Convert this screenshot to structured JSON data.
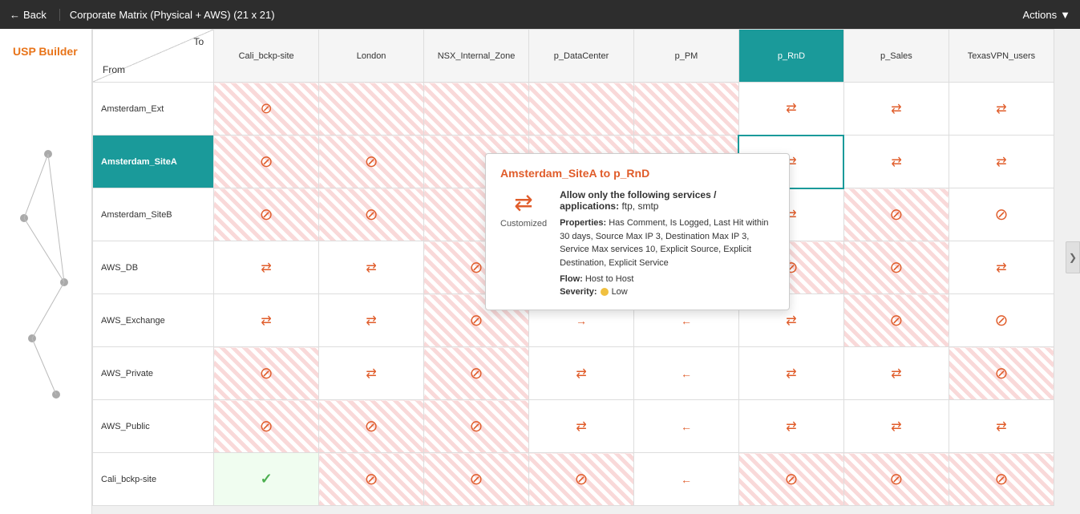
{
  "topbar": {
    "back_label": "Back",
    "title": "Corporate Matrix (Physical + AWS)  (21 x 21)",
    "actions_label": "Actions"
  },
  "sidebar": {
    "logo": "USP Builder"
  },
  "matrix": {
    "corner_to": "To",
    "corner_from": "From",
    "columns": [
      "Cali_bckp-site",
      "London",
      "NSX_Internal_Zone",
      "p_DataCenter",
      "p_PM",
      "p_RnD",
      "p_Sales",
      "TexasVPN_users"
    ],
    "rows": [
      {
        "label": "Amsterdam_Ext",
        "active": false
      },
      {
        "label": "Amsterdam_SiteA",
        "active": true
      },
      {
        "label": "Amsterdam_SiteB",
        "active": false
      },
      {
        "label": "AWS_DB",
        "active": false
      },
      {
        "label": "AWS_Exchange",
        "active": false
      },
      {
        "label": "AWS_Private",
        "active": false
      },
      {
        "label": "AWS_Public",
        "active": false
      },
      {
        "label": "Cali_bckp-site",
        "active": false
      }
    ]
  },
  "tooltip": {
    "title_from": "Amsterdam_SiteA",
    "title_to": "p_RnD",
    "icon_label": "Customized",
    "allow_label": "Allow only the following services / applications:",
    "allow_value": "ftp, smtp",
    "properties_label": "Properties:",
    "properties_value": "Has Comment, Is Logged, Last Hit within 30 days, Source Max IP 3, Destination Max IP 3, Service Max services 10, Explicit Source, Explicit Destination, Explicit Service",
    "flow_label": "Flow:",
    "flow_value": "Host to Host",
    "severity_label": "Severity:",
    "severity_value": "Low"
  },
  "icons": {
    "blocked": "⊘",
    "arrows": "⇆",
    "arrow_right": "→",
    "arrow_left": "←",
    "check": "✓",
    "chevron_left": "❮",
    "chevron_right": "❯",
    "back_arrow": "←",
    "dropdown": "▾"
  }
}
